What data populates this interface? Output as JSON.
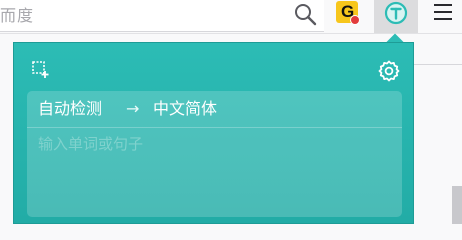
{
  "browser": {
    "url_text": "而度",
    "icons": {
      "search": "search-icon",
      "grammarly": "grammarly-extension-icon",
      "translate": "translate-extension-icon",
      "menu": "hamburger-menu-icon"
    },
    "grammarly_letter": "G"
  },
  "popup": {
    "icons": {
      "screenshot": "screenshot-translate-icon",
      "settings": "gear-icon"
    },
    "source_language": "自动检测",
    "arrow": "→",
    "target_language": "中文简体",
    "input": {
      "value": "",
      "placeholder": "输入单词或句子"
    },
    "colors": {
      "accent": "#2cbcb5",
      "accent_dark": "#22aca6"
    }
  }
}
